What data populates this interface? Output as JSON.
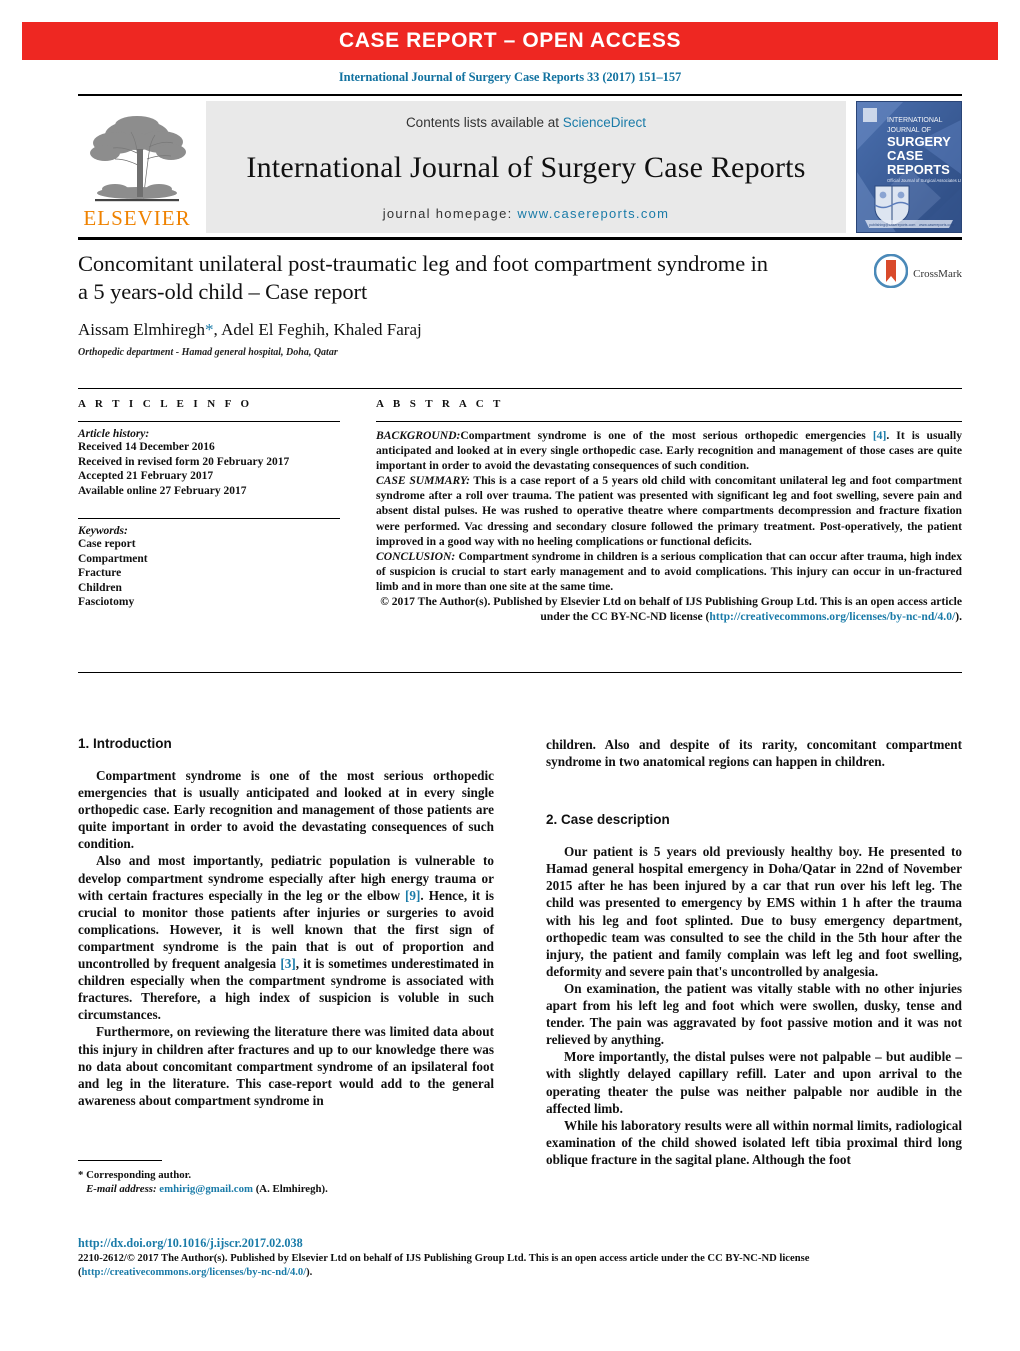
{
  "banner": {
    "label": "CASE REPORT – OPEN ACCESS",
    "color": "#ee2722"
  },
  "citation": "International Journal of Surgery Case Reports 33 (2017) 151–157",
  "masthead": {
    "publisher": "ELSEVIER",
    "contents_prefix": "Contents lists available at ",
    "contents_link": "ScienceDirect",
    "journal_title": "International Journal of Surgery Case Reports",
    "homepage_prefix": "journal homepage: ",
    "homepage_link": "www.casereports.com",
    "cover": {
      "line1": "INTERNATIONAL",
      "line2": "JOURNAL OF",
      "line3": "SURGERY",
      "line4": "CASE",
      "line5": "REPORTS",
      "subtitle": "Official Journal of Surgical Associates Ltd",
      "footer_left": "publishing@casereports.com",
      "footer_right": "www.casereports.com"
    }
  },
  "article": {
    "title": "Concomitant unilateral post-traumatic leg and foot compartment syndrome in a 5 years-old child – Case report",
    "authors_before_star": "Aissam Elmhiregh",
    "authors_after_star": ", Adel El Feghih, Khaled Faraj",
    "affiliation": "Orthopedic department - Hamad general hospital, Doha, Qatar",
    "crossmark_label": "CrossMark"
  },
  "article_info": {
    "heading": "A R T I C L E    I N F O",
    "history_label": "Article history:",
    "history": [
      "Received 14 December 2016",
      "Received in revised form 20 February 2017",
      "Accepted 21  February 2017",
      "Available online 27 February 2017"
    ],
    "keywords_label": "Keywords:",
    "keywords": [
      "Case report",
      "Compartment",
      "Fracture",
      "Children",
      "Fasciotomy"
    ]
  },
  "abstract": {
    "heading": "A B S T R A C T",
    "background_label": "BACKGROUND:",
    "background_text_1": "Compartment syndrome is one of the most serious orthopedic emergencies ",
    "background_ref": "[4]",
    "background_text_2": ". It is usually anticipated and looked at in every single orthopedic case. Early recognition and management of those cases are quite important in order to avoid the devastating consequences of such condition.",
    "case_summary_label": "CASE SUMMARY:",
    "case_summary_text": " This is a case report of a 5 years old child with concomitant unilateral leg and foot compartment syndrome after a roll over trauma. The patient was presented with significant leg and foot swelling, severe pain and absent distal pulses. He was rushed to operative theatre where compartments decompression and fracture fixation were performed. Vac dressing and secondary closure followed the primary treatment. Post-operatively, the patient improved in a good way with no heeling complications or functional deficits.",
    "conclusion_label": "CONCLUSION:",
    "conclusion_text": " Compartment syndrome in children is a serious complication that can occur after trauma, high index of suspicion is crucial to start early management and to avoid complications. This injury can occur in un-fractured limb and in more than one site at the same time.",
    "copyright_text_1": "© 2017 The Author(s). Published by Elsevier Ltd on behalf of IJS Publishing Group Ltd. This is an open access article under the CC BY-NC-ND license (",
    "copyright_link": "http://creativecommons.org/licenses/by-nc-nd/4.0/",
    "copyright_text_2": ")."
  },
  "body": {
    "left": {
      "section_number_title": "1.  Introduction",
      "p1": "Compartment syndrome is one of the most serious orthopedic emergencies that is usually anticipated and looked at in every single orthopedic case. Early recognition and management of those patients are quite important in order to avoid the devastating consequences of such condition.",
      "p2_a": "Also and most importantly, pediatric population is vulnerable to develop compartment syndrome especially after high energy trauma or with certain fractures especially in the leg or the elbow ",
      "p2_ref1": "[9]",
      "p2_b": ". Hence, it is crucial to monitor those patients after injuries or surgeries to avoid complications. However, it is well known that the first sign of compartment syndrome is the pain that is out of proportion and uncontrolled by frequent analgesia ",
      "p2_ref2": "[3]",
      "p2_c": ", it is sometimes underestimated in children especially when the compartment syndrome is associated with fractures. Therefore, a high index of suspicion is voluble in such circumstances.",
      "p3": "Furthermore, on reviewing the literature there was limited data about this injury in children after fractures and up to our knowledge there was no data about concomitant compartment syndrome of an ipsilateral foot and leg in the literature. This case-report would add to the general awareness about compartment syndrome in"
    },
    "right": {
      "continuation": "children. Also and despite of its rarity, concomitant compartment syndrome in two anatomical regions can happen in children.",
      "section_number_title": "2.  Case description",
      "p1": "Our patient is 5 years old previously healthy boy. He presented to Hamad general hospital emergency in Doha/Qatar in 22nd of November 2015 after he has been injured by a car that run over his left leg. The child was presented to emergency by EMS within 1 h after the trauma with his leg and foot splinted. Due to busy emergency department, orthopedic team was consulted to see the child in the 5th hour after the injury, the patient and family complain was left leg and foot swelling, deformity and severe pain that's uncontrolled by analgesia.",
      "p2": "On examination, the patient was vitally stable with no other injuries apart from his left leg and foot which were swollen, dusky, tense and tender. The pain was aggravated by foot passive motion and it was not relieved by anything.",
      "p3": "More importantly, the distal pulses were not palpable – but audible – with slightly delayed capillary refill. Later and upon arrival to the operating theater the pulse was neither palpable nor audible in the affected limb.",
      "p4": "While his laboratory results were all within normal limits, radiological examination of the child showed isolated left tibia proximal third long oblique fracture in the sagital plane. Although the foot"
    }
  },
  "footer": {
    "corresponding_author": "*  Corresponding author.",
    "email_label": "E-mail address:",
    "email": "emhirig@gmail.com",
    "email_suffix": " (A. Elmhiregh).",
    "doi": "http://dx.doi.org/10.1016/j.ijscr.2017.02.038",
    "license_text_1": "2210-2612/© 2017 The Author(s). Published by Elsevier Ltd on behalf of IJS Publishing Group Ltd. This is an open access article under the CC BY-NC-ND license (",
    "license_link_1": "http://",
    "license_link_2": "creativecommons.org/licenses/by-nc-nd/4.0/",
    "license_text_2": ")."
  }
}
